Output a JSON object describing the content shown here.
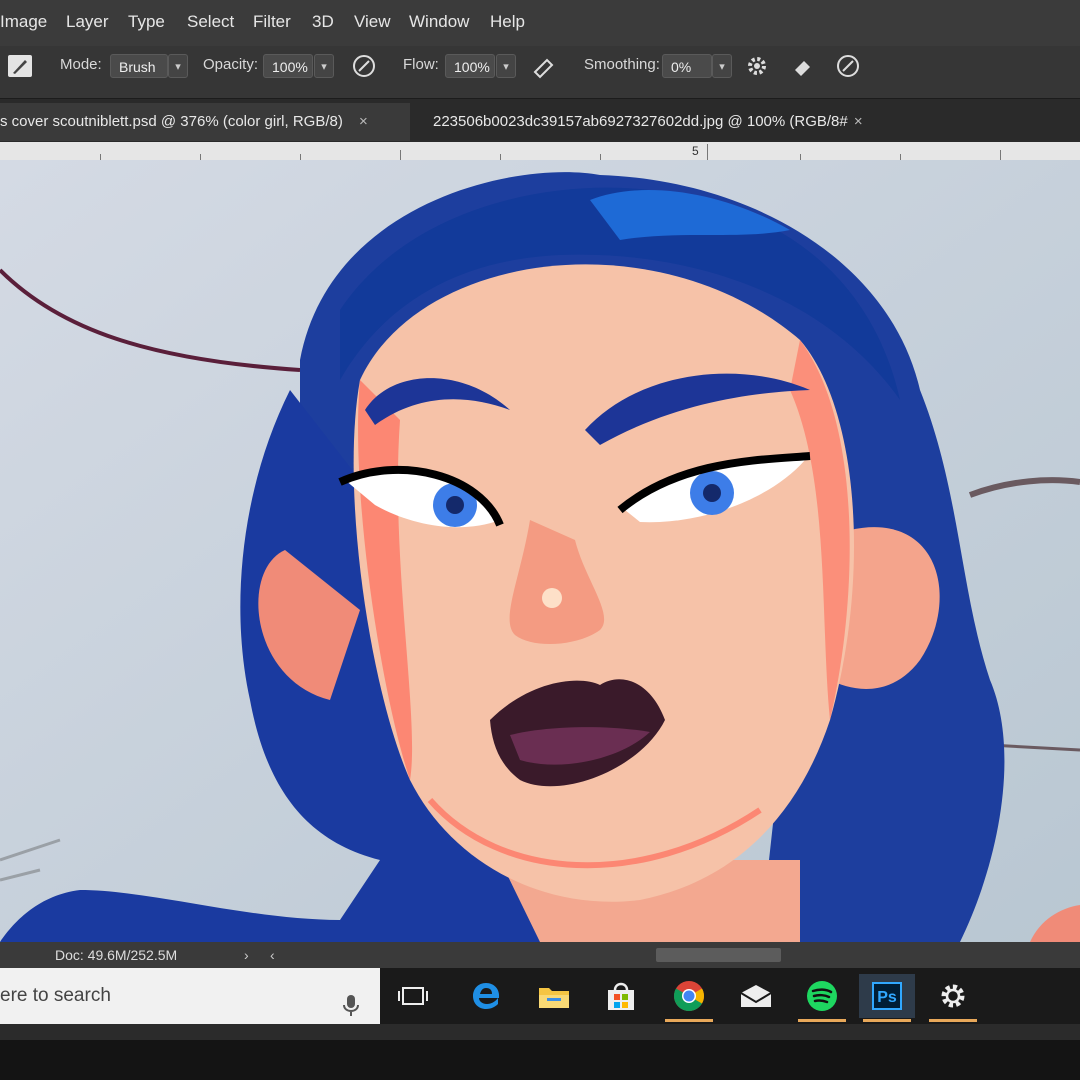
{
  "menubar": {
    "items": [
      "Image",
      "Layer",
      "Type",
      "Select",
      "Filter",
      "3D",
      "View",
      "Window",
      "Help"
    ]
  },
  "options": {
    "mode_label": "Mode:",
    "mode_value": "Brush",
    "opacity_label": "Opacity:",
    "opacity_value": "100%",
    "flow_label": "Flow:",
    "flow_value": "100%",
    "smoothing_label": "Smoothing:",
    "smoothing_value": "0%"
  },
  "tabs": [
    {
      "label": "s cover scoutniblett.psd @ 376% (color girl, RGB/8)",
      "close": "×"
    },
    {
      "label": "223506b0023dc39157ab6927327602dd.jpg @ 100% (RGB/8#",
      "close": "×"
    }
  ],
  "ruler": {
    "number": "5"
  },
  "status": {
    "doc": "Doc: 49.6M/252.5M"
  },
  "taskbar": {
    "search_placeholder": "ere to search",
    "ps_label": "Ps",
    "icons": [
      "task-view-icon",
      "edge-icon",
      "file-explorer-icon",
      "store-icon",
      "chrome-icon",
      "mail-icon",
      "spotify-icon",
      "photoshop-icon",
      "settings-icon"
    ]
  },
  "colors": {
    "hair": "#1a3fa8",
    "skin": "#f4b79a",
    "lips": "#3a1a2a",
    "canvas_bg": "#c4cfd8",
    "taskbar_indicator": "#e8a85a"
  }
}
